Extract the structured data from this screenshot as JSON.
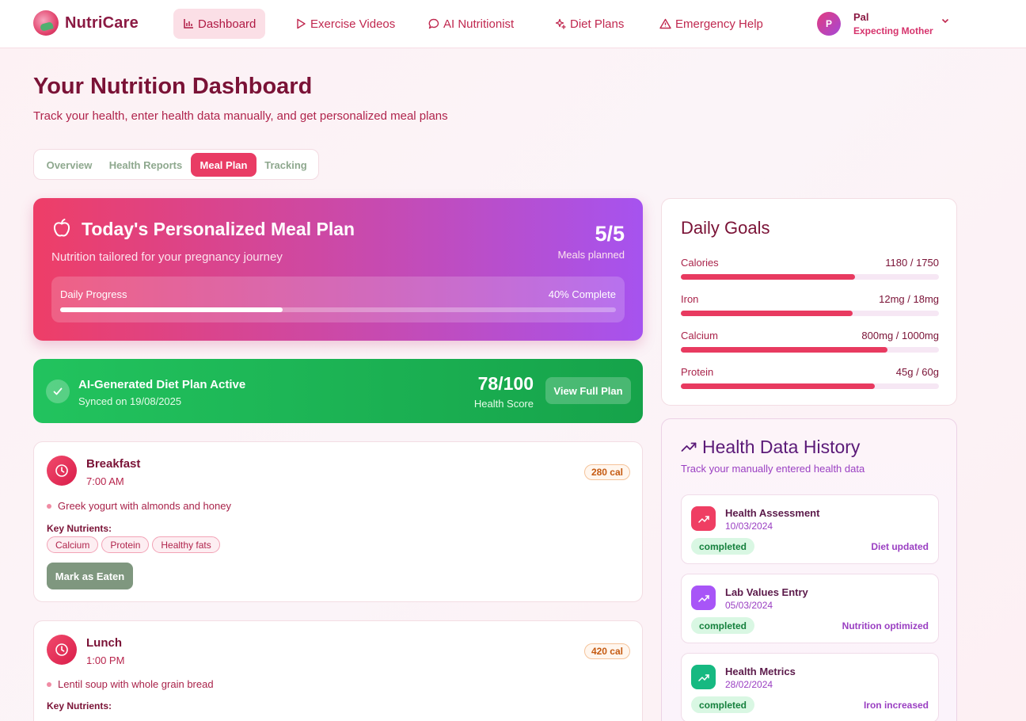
{
  "brand": {
    "name": "NutriCare"
  },
  "nav": {
    "items": [
      {
        "label": "Dashboard",
        "icon": "bar-chart-icon",
        "active": true
      },
      {
        "label": "Exercise Videos",
        "icon": "play-icon",
        "active": false
      },
      {
        "label": "AI Nutritionist",
        "icon": "chat-bubble-icon",
        "active": false
      },
      {
        "label": "Diet Plans",
        "icon": "sparkles-icon",
        "active": false
      },
      {
        "label": "Emergency Help",
        "icon": "warning-icon",
        "active": false
      }
    ]
  },
  "user": {
    "initial": "P",
    "name": "Pal",
    "role": "Expecting Mother"
  },
  "header": {
    "title": "Your Nutrition Dashboard",
    "subtitle": "Track your health, enter health data manually, and get personalized meal plans"
  },
  "tabs": [
    {
      "label": "Overview",
      "active": false
    },
    {
      "label": "Health Reports",
      "active": false
    },
    {
      "label": "Meal Plan",
      "active": true
    },
    {
      "label": "Tracking",
      "active": false
    }
  ],
  "hero": {
    "title": "Today's Personalized Meal Plan",
    "subtitle": "Nutrition tailored for your pregnancy journey",
    "meals_count": "5/5",
    "meals_label": "Meals planned",
    "progress_label": "Daily Progress",
    "progress_text": "40% Complete",
    "progress_fraction": 0.4
  },
  "ai_plan": {
    "title": "AI-Generated Diet Plan Active",
    "synced": "Synced on 19/08/2025",
    "score": "78/100",
    "score_label": "Health Score",
    "button": "View Full Plan"
  },
  "meals": [
    {
      "name": "Breakfast",
      "time": "7:00 AM",
      "calories": "280 cal",
      "food": "Greek yogurt with almonds and honey",
      "nutrients_label": "Key Nutrients:",
      "nutrients": [
        "Calcium",
        "Protein",
        "Healthy fats"
      ],
      "button": "Mark as Eaten"
    },
    {
      "name": "Lunch",
      "time": "1:00 PM",
      "calories": "420 cal",
      "food": "Lentil soup with whole grain bread",
      "nutrients_label": "Key Nutrients:"
    }
  ],
  "goals": {
    "title": "Daily Goals",
    "items": [
      {
        "label": "Calories",
        "value": "1180 / 1750",
        "fraction": 0.674
      },
      {
        "label": "Iron",
        "value": "12mg / 18mg",
        "fraction": 0.667
      },
      {
        "label": "Calcium",
        "value": "800mg / 1000mg",
        "fraction": 0.8
      },
      {
        "label": "Protein",
        "value": "45g / 60g",
        "fraction": 0.75
      }
    ]
  },
  "history": {
    "title": "Health Data History",
    "subtitle": "Track your manually entered health data",
    "items": [
      {
        "title": "Health Assessment",
        "date": "10/03/2024",
        "status": "completed",
        "result": "Diet updated",
        "color": "#ef3e63"
      },
      {
        "title": "Lab Values Entry",
        "date": "05/03/2024",
        "status": "completed",
        "result": "Nutrition optimized",
        "color": "#a855f7"
      },
      {
        "title": "Health Metrics",
        "date": "28/02/2024",
        "status": "completed",
        "result": "Iron increased",
        "color": "#16b981"
      }
    ]
  },
  "colors": {
    "accent": "#e93c64",
    "brand_dark": "#7a1236",
    "success": "#16a34a",
    "purple": "#a653ef"
  }
}
